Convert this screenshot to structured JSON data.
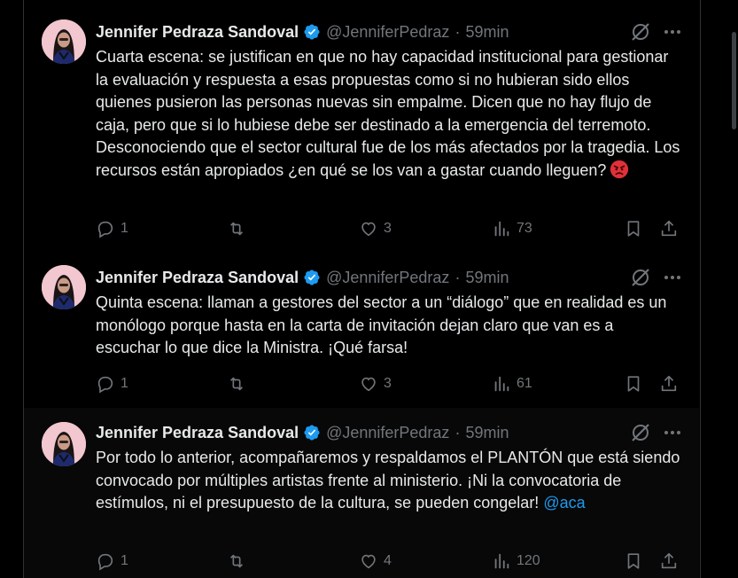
{
  "tweets": [
    {
      "name": "Jennifer Pedraza Sandoval",
      "handle": "@JenniferPedraz",
      "dot": "·",
      "time": "59min",
      "text": "Cuarta escena: se justifican en que no hay capacidad institucional para gestionar la evaluación y respuesta a esas propuestas como si no hubieran sido ellos quienes pusieron las personas nuevas sin empalme. Dicen que no hay flujo de caja, pero que si lo hubiese debe ser destinado a la emergencia del terremoto. Desconociendo que el sector cultural fue de los más afectados por la tragedia. Los recursos están apropiados ¿en qué se los van a gastar cuando lleguen?",
      "emoji": "angry-face",
      "replies": "1",
      "retweets": "",
      "likes": "3",
      "views": "73"
    },
    {
      "name": "Jennifer Pedraza Sandoval",
      "handle": "@JenniferPedraz",
      "dot": "·",
      "time": "59min",
      "text": "Quinta escena: llaman a gestores del sector a un “diálogo” que en realidad es un monólogo porque hasta en la carta de invitación dejan claro que van es a escuchar lo que dice la Ministra. ¡Qué farsa!",
      "replies": "1",
      "retweets": "",
      "likes": "3",
      "views": "61"
    },
    {
      "name": "Jennifer Pedraza Sandoval",
      "handle": "@JenniferPedraz",
      "dot": "·",
      "time": "59min",
      "text": "Por todo lo anterior, acompañaremos y respaldamos el PLANTÓN que está siendo convocado por múltiples artistas frente al ministerio. ¡Ni la convocatoria de estímulos, ni el presupuesto de la cultura, se pueden congelar!",
      "mention": "@aca",
      "replies": "1",
      "retweets": "",
      "likes": "4",
      "views": "120"
    }
  ],
  "colors": {
    "background": "#000000",
    "text": "#e7e9ea",
    "muted": "#71767b",
    "accent": "#1d9bf0",
    "divider": "#2f3336"
  },
  "icons": [
    "verified-badge-icon",
    "grok-icon",
    "more-icon",
    "reply-icon",
    "retweet-icon",
    "like-icon",
    "views-icon",
    "bookmark-icon",
    "share-icon",
    "angry-face-icon"
  ]
}
